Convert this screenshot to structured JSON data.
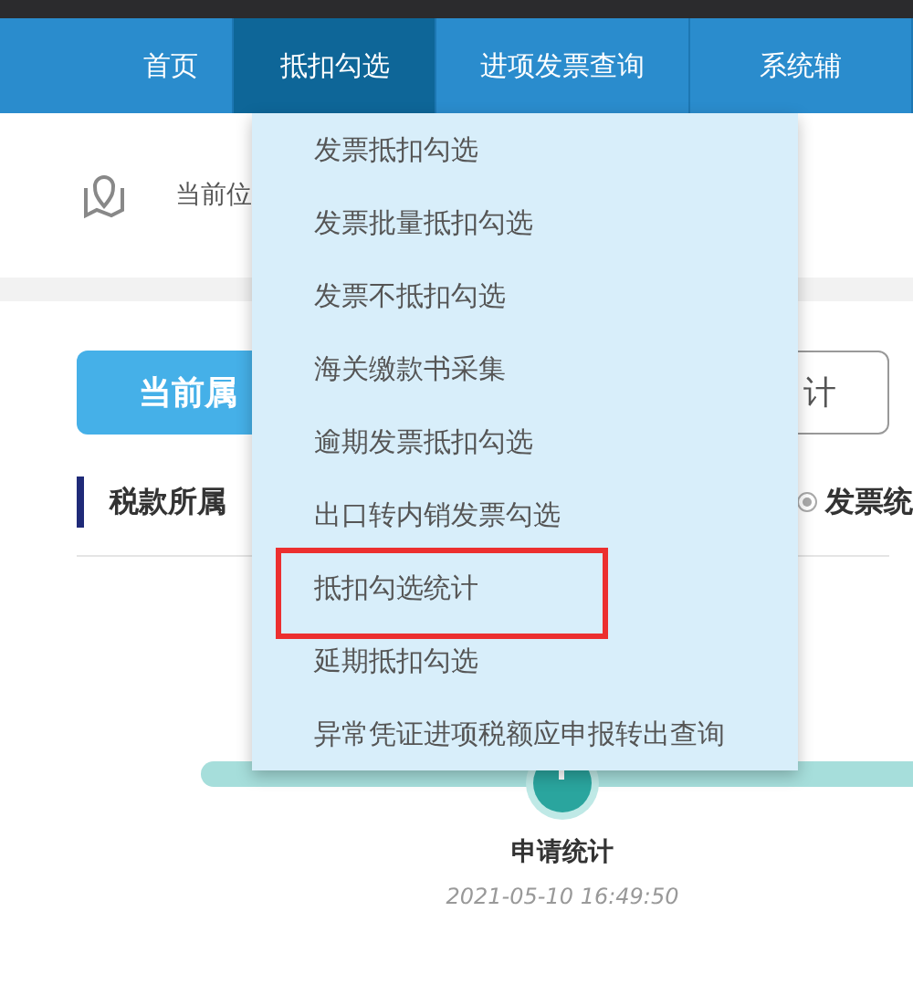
{
  "top_nav": {
    "tabs": [
      {
        "label": "首页",
        "selected": false
      },
      {
        "label": "抵扣勾选",
        "selected": true
      },
      {
        "label": "进项发票查询",
        "selected": false
      },
      {
        "label": "系统辅",
        "selected": false
      }
    ]
  },
  "breadcrumb": {
    "text": "当前位"
  },
  "period_button": {
    "label": "当前属"
  },
  "stats_button": {
    "label": "计"
  },
  "section": {
    "title": "税款所属",
    "option": {
      "label": "发票统",
      "selected": true
    }
  },
  "timeline": {
    "steps": [
      {
        "label": "申请统计",
        "time": "2021-05-10 16:49:50"
      }
    ]
  },
  "dropdown": {
    "items": [
      {
        "label": "发票抵扣勾选",
        "highlighted": false
      },
      {
        "label": "发票批量抵扣勾选",
        "highlighted": false
      },
      {
        "label": "发票不抵扣勾选",
        "highlighted": false
      },
      {
        "label": "海关缴款书采集",
        "highlighted": false
      },
      {
        "label": "逾期发票抵扣勾选",
        "highlighted": false
      },
      {
        "label": "出口转内销发票勾选",
        "highlighted": false
      },
      {
        "label": "抵扣勾选统计",
        "highlighted": true
      },
      {
        "label": "延期抵扣勾选",
        "highlighted": false
      },
      {
        "label": "异常凭证进项税额应申报转出查询",
        "highlighted": false
      }
    ]
  }
}
